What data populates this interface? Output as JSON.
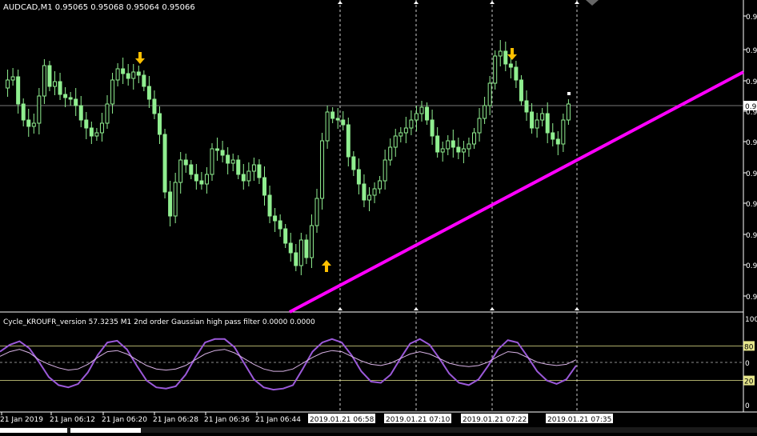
{
  "main": {
    "header": "AUDCAD,M1  0.95065 0.95068 0.95064 0.95066",
    "price_labels": [
      "0.9",
      "0.9",
      "0.9",
      "0.9",
      "0.9",
      "0.9",
      "0.9",
      "0.9",
      "0.9",
      "0.9"
    ],
    "current_price_label": "0.9"
  },
  "indicator": {
    "header": "Cycle_KROUFR_version 57.3235  M1 2nd order Gaussian high pass filter 0.0000 0.0000",
    "levels": [
      "100",
      "80",
      "0",
      "20",
      "0"
    ]
  },
  "time_axis": {
    "labels": [
      "21 Jan 2019",
      "21 Jan 06:12",
      "21 Jan 06:20",
      "21 Jan 06:28",
      "21 Jan 06:36",
      "21 Jan 06:44"
    ],
    "highlighted": [
      "2019.01.21 06:58",
      "2019.01.21 07:10",
      "2019.01.21 07:22",
      "2019.01.21 07:35"
    ]
  },
  "colors": {
    "background": "#000000",
    "candle": "#90ee90",
    "trendline": "#ff00ff",
    "arrow": "#ffc000",
    "cycle_line": "#9b59d9",
    "signal_line": "#d9b3e6",
    "level_line": "#e6e68c",
    "separator": "#ffffff"
  },
  "chart_data": [
    {
      "type": "candlestick",
      "title": "AUDCAD,M1",
      "timeframe": "M1",
      "last_quote": {
        "bid": 0.95065,
        "high": 0.95068,
        "low": 0.95064,
        "close": 0.95066
      },
      "markers": [
        {
          "kind": "sell-arrow",
          "near": "21 Jan 06:20"
        },
        {
          "kind": "buy-arrow",
          "near": "2019.01.21 06:58"
        },
        {
          "kind": "sell-arrow",
          "near": "2019.01.21 07:22"
        }
      ],
      "trendline": {
        "direction": "up",
        "from": "21 Jan 06:47",
        "to": "2019.01.21 07:38"
      },
      "vertical_markers": [
        "2019.01.21 06:58",
        "2019.01.21 07:10",
        "2019.01.21 07:22",
        "2019.01.21 07:35"
      ]
    },
    {
      "type": "line",
      "title": "Cycle_KROUFR_version 57.3235",
      "ylim": [
        0,
        100
      ],
      "levels": [
        80,
        20
      ],
      "series": [
        {
          "name": "Cycle",
          "values": [
            70,
            82,
            88,
            76,
            52,
            26,
            12,
            8,
            14,
            34,
            64,
            86,
            89,
            74,
            46,
            20,
            8,
            6,
            10,
            30,
            60,
            86,
            92,
            92,
            78,
            50,
            22,
            8,
            4,
            6,
            12,
            40,
            70,
            86,
            92,
            86,
            64,
            36,
            18,
            16,
            30,
            58,
            84,
            92,
            82,
            58,
            32,
            16,
            12,
            22,
            46,
            74,
            90,
            86,
            62,
            36,
            20,
            14,
            22,
            46
          ]
        },
        {
          "name": "Signal",
          "values": [
            62,
            70,
            74,
            68,
            56,
            48,
            42,
            38,
            40,
            48,
            60,
            70,
            72,
            66,
            56,
            46,
            40,
            38,
            40,
            46,
            56,
            66,
            72,
            74,
            68,
            58,
            48,
            40,
            36,
            36,
            40,
            50,
            60,
            68,
            72,
            70,
            62,
            54,
            48,
            46,
            50,
            58,
            66,
            70,
            66,
            58,
            50,
            46,
            44,
            46,
            52,
            62,
            70,
            68,
            60,
            52,
            48,
            46,
            48,
            56
          ]
        }
      ]
    }
  ]
}
